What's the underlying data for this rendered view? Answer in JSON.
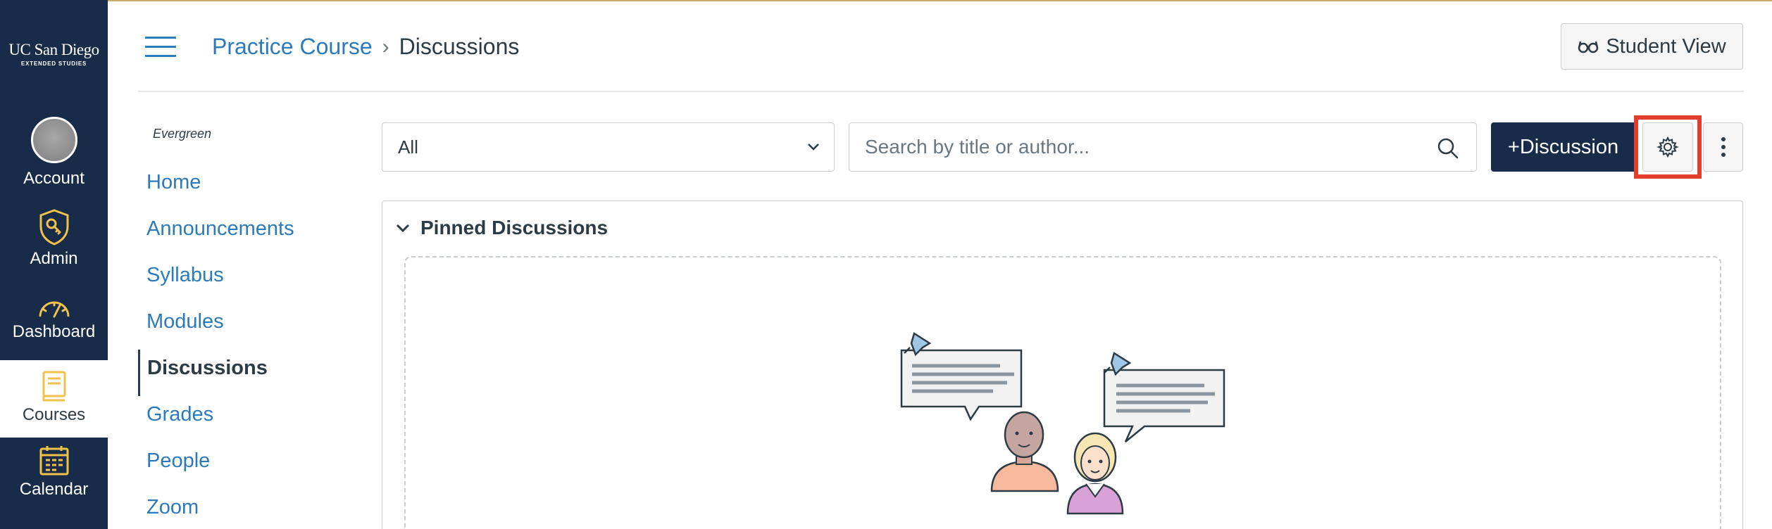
{
  "brand": {
    "name": "UC San Diego",
    "sub": "EXTENDED STUDIES"
  },
  "global_nav": {
    "items": [
      {
        "label": "Account",
        "icon": "avatar"
      },
      {
        "label": "Admin",
        "icon": "shield-key-icon"
      },
      {
        "label": "Dashboard",
        "icon": "speedometer-icon"
      },
      {
        "label": "Courses",
        "icon": "book-icon",
        "active": true
      },
      {
        "label": "Calendar",
        "icon": "calendar-icon"
      }
    ]
  },
  "header": {
    "breadcrumb": {
      "course": "Practice Course",
      "separator": "›",
      "current": "Discussions"
    },
    "student_view_label": "Student View"
  },
  "course_nav": {
    "term": "Evergreen",
    "items": [
      {
        "label": "Home"
      },
      {
        "label": "Announcements"
      },
      {
        "label": "Syllabus"
      },
      {
        "label": "Modules"
      },
      {
        "label": "Discussions",
        "active": true
      },
      {
        "label": "Grades"
      },
      {
        "label": "People"
      },
      {
        "label": "Zoom"
      }
    ]
  },
  "toolbar": {
    "filter_value": "All",
    "search_placeholder": "Search by title or author...",
    "new_discussion_label": "+Discussion"
  },
  "pinned": {
    "title": "Pinned Discussions"
  },
  "colors": {
    "nav_bg": "#182b49",
    "link": "#2b7abc",
    "text": "#2d3b45",
    "accent_gold": "#f0c24a",
    "highlight": "#e33d2c"
  }
}
